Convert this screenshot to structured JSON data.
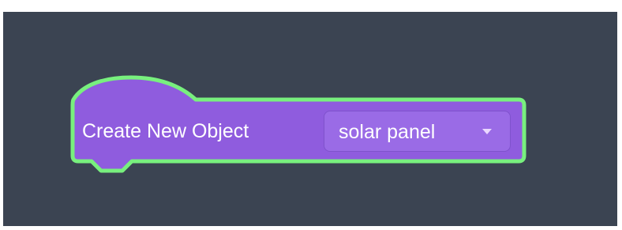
{
  "block": {
    "label": "Create New Object",
    "dropdown_value": "solar panel"
  },
  "colors": {
    "workspace_background": "#3b4452",
    "block_fill": "#8f5cde",
    "block_outline": "#78f07e",
    "dropdown_fill": "#9a6be6",
    "text": "#ffffff"
  },
  "icons": {
    "dropdown_caret": "chevron-down-icon"
  }
}
